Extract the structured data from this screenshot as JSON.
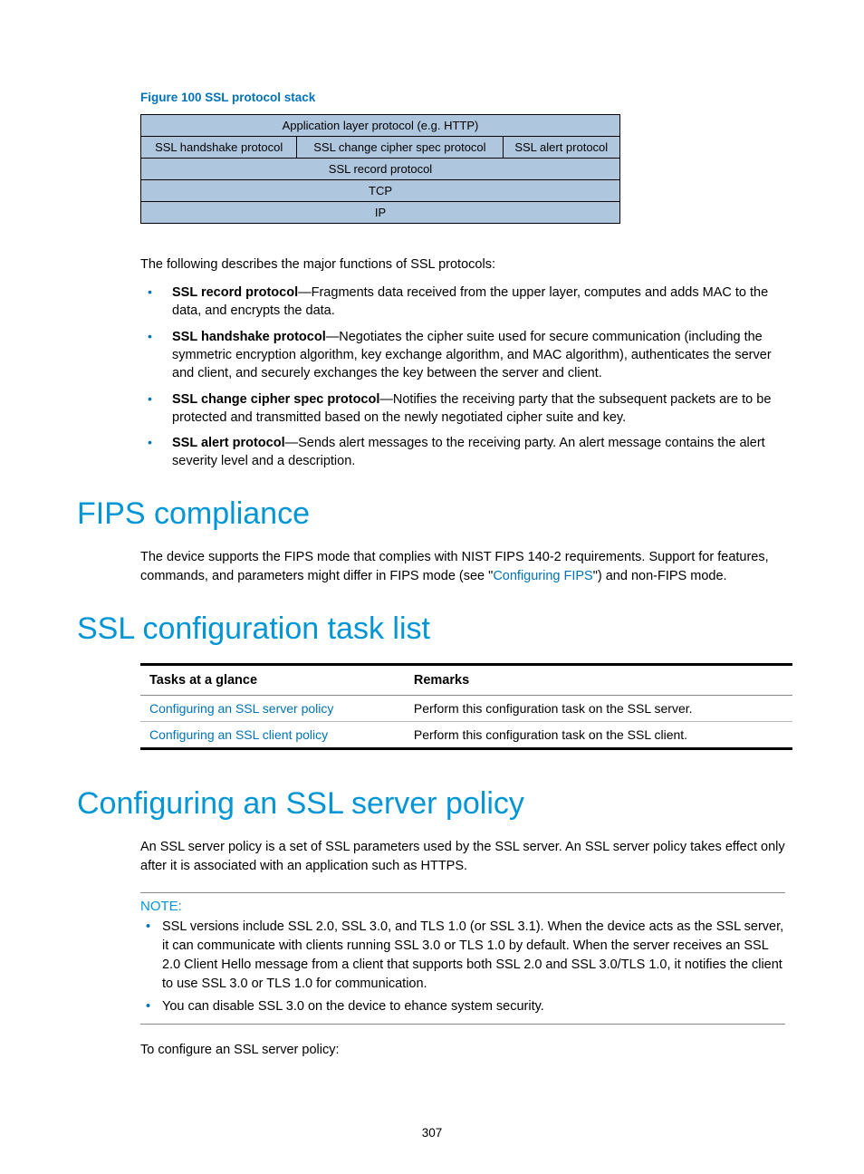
{
  "figure": {
    "label": "Figure 100 SSL protocol stack",
    "rows": {
      "r1": "Application layer protocol (e.g. HTTP)",
      "r2a": "SSL handshake protocol",
      "r2b": "SSL change cipher spec protocol",
      "r2c": "SSL alert protocol",
      "r3": "SSL record protocol",
      "r4": "TCP",
      "r5": "IP"
    }
  },
  "intro": "The following describes the major functions of SSL protocols:",
  "protocols": {
    "record": {
      "title": "SSL record protocol",
      "desc": "—Fragments data received from the upper layer, computes and adds MAC to the data, and encrypts the data."
    },
    "handshake": {
      "title": "SSL handshake protocol",
      "desc": "—Negotiates the cipher suite used for secure communication (including the symmetric encryption algorithm, key exchange algorithm, and MAC algorithm), authenticates the server and client, and securely exchanges the key between the server and client."
    },
    "cipher": {
      "title": "SSL change cipher spec protocol",
      "desc": "—Notifies the receiving party that the subsequent packets are to be protected and transmitted based on the newly negotiated cipher suite and key."
    },
    "alert": {
      "title": "SSL alert protocol",
      "desc": "—Sends alert messages to the receiving party. An alert message contains the alert severity level and a description."
    }
  },
  "headings": {
    "fips": "FIPS compliance",
    "tasklist": "SSL configuration task list",
    "server_policy": "Configuring an SSL server policy"
  },
  "fips": {
    "text_before": "The device supports the FIPS mode that complies with NIST FIPS 140-2 requirements. Support for features, commands, and parameters might differ in FIPS mode (see \"",
    "link": "Configuring FIPS",
    "text_after": "\") and non-FIPS mode."
  },
  "task_table": {
    "headers": {
      "tasks": "Tasks at a glance",
      "remarks": "Remarks"
    },
    "rows": [
      {
        "task": "Configuring an SSL server policy",
        "remark": "Perform this configuration task on the SSL server."
      },
      {
        "task": "Configuring an SSL client policy",
        "remark": "Perform this configuration task on the SSL client."
      }
    ]
  },
  "server_policy_para": "An SSL server policy is a set of SSL parameters used by the SSL server. An SSL server policy takes effect only after it is associated with an application such as HTTPS.",
  "note": {
    "label": "NOTE:",
    "items": {
      "n1": "SSL versions include SSL 2.0, SSL 3.0, and TLS 1.0 (or SSL 3.1). When the device acts as the SSL server, it can communicate with clients running SSL 3.0 or TLS 1.0 by default. When the server receives an SSL 2.0 Client Hello message from a client that supports both SSL 2.0 and SSL 3.0/TLS 1.0, it notifies the client to use SSL 3.0 or TLS 1.0 for communication.",
      "n2": "You can disable SSL 3.0 on the device to ehance system security."
    }
  },
  "closing": "To configure an SSL server policy:",
  "page_number": "307"
}
